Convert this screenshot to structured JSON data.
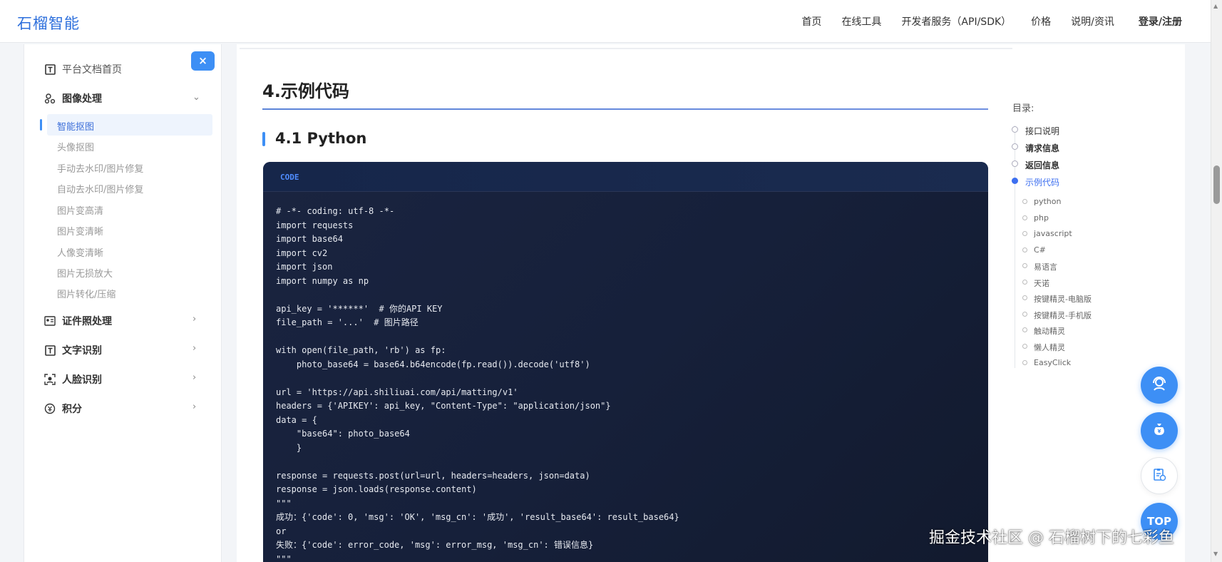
{
  "brand": "石榴智能",
  "nav": {
    "home": "首页",
    "tools": "在线工具",
    "dev": "开发者服务（API/SDK）",
    "price": "价格",
    "docs": "说明/资讯",
    "login": "登录/注册"
  },
  "sidebar": {
    "close": "×",
    "home": "平台文档首页",
    "image": "图像处理",
    "image_subs": [
      "智能抠图",
      "头像抠图",
      "手动去水印/图片修复",
      "自动去水印/图片修复",
      "图片变高清",
      "图片变清晰",
      "人像变清晰",
      "图片无损放大",
      "图片转化/压缩"
    ],
    "idphoto": "证件照处理",
    "ocr": "文字识别",
    "face": "人脸识别",
    "points": "积分"
  },
  "content": {
    "h4": "4.示例代码",
    "h41": "4.1 Python",
    "code_tag": "CODE",
    "code": "# -*- coding: utf-8 -*-\nimport requests\nimport base64\nimport cv2\nimport json\nimport numpy as np\n\napi_key = '******'  # 你的API KEY\nfile_path = '...'  # 图片路径\n\nwith open(file_path, 'rb') as fp:\n    photo_base64 = base64.b64encode(fp.read()).decode('utf8')\n\nurl = 'https://api.shiliuai.com/api/matting/v1'\nheaders = {'APIKEY': api_key, \"Content-Type\": \"application/json\"}\ndata = {\n    \"base64\": photo_base64\n    }\n\nresponse = requests.post(url=url, headers=headers, json=data)\nresponse = json.loads(response.content)\n\"\"\"\n成功：{'code': 0, 'msg': 'OK', 'msg_cn': '成功', 'result_base64': result_base64}\nor\n失败：{'code': error_code, 'msg': error_msg, 'msg_cn': 错误信息}\n\"\"\""
  },
  "toc": {
    "title": "目录:",
    "items": [
      "接口说明",
      "请求信息",
      "返回信息",
      "示例代码"
    ],
    "subs": [
      "python",
      "php",
      "javascript",
      "C#",
      "易语言",
      "天诺",
      "按键精灵-电脑版",
      "按键精灵-手机版",
      "触动精灵",
      "懒人精灵",
      "EasyClick"
    ]
  },
  "fab": {
    "top": "TOP"
  },
  "watermark": "掘金技术社区 @ 石榴树下的七彩鱼"
}
